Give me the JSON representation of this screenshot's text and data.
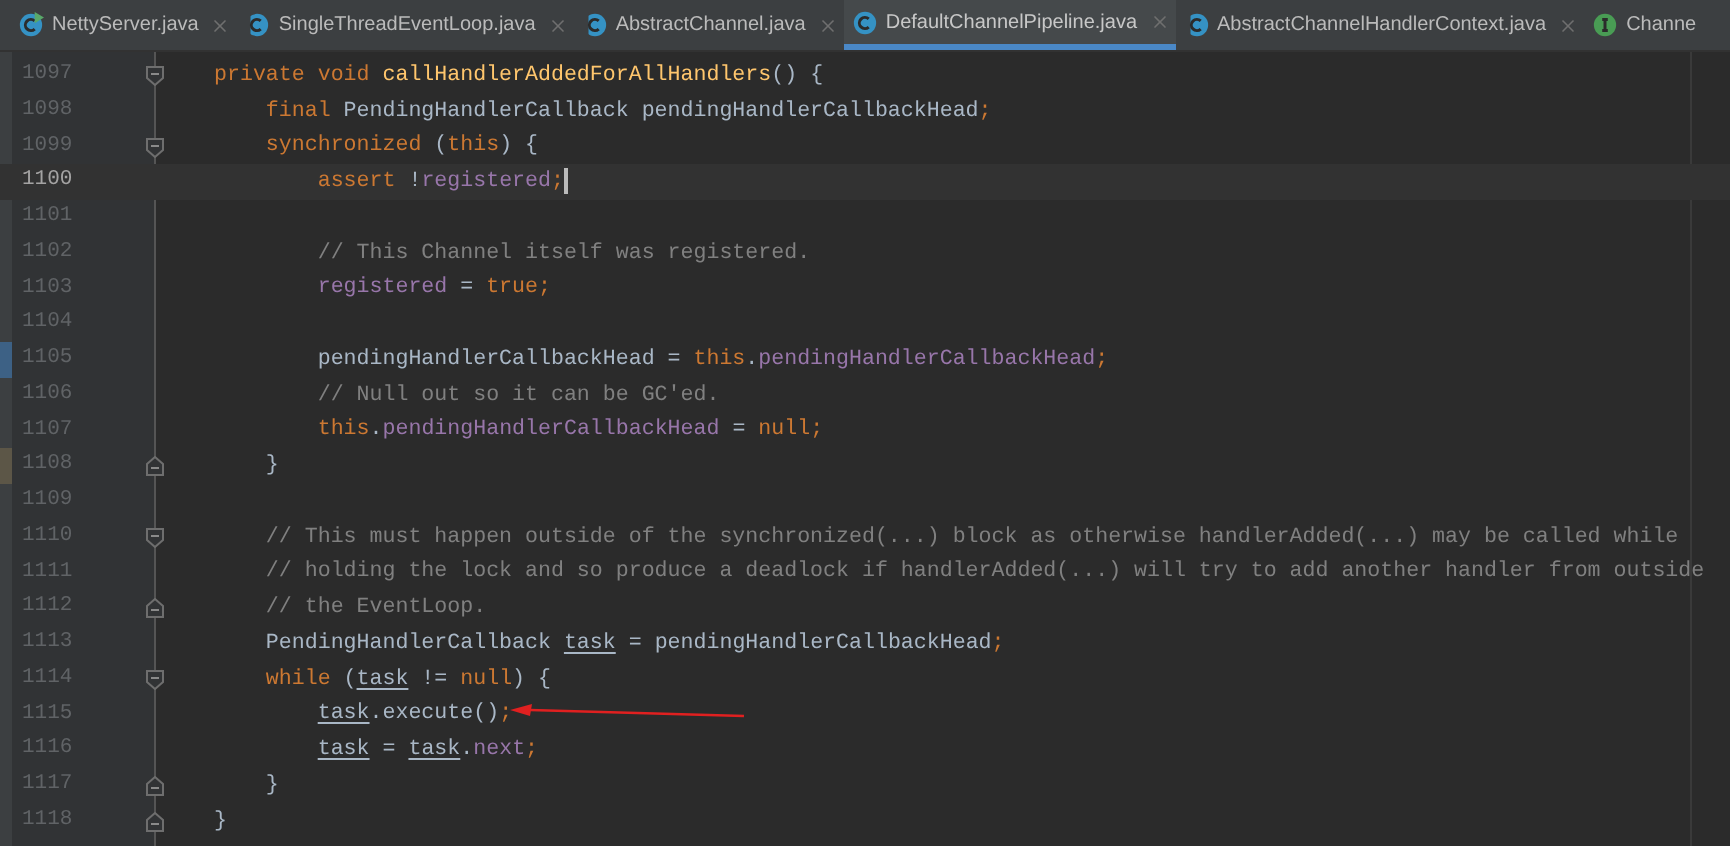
{
  "tabs": [
    {
      "label": "NettyServer.java",
      "kind": "class-run",
      "selected": false
    },
    {
      "label": "SingleThreadEventLoop.java",
      "kind": "abstract-class",
      "selected": false
    },
    {
      "label": "AbstractChannel.java",
      "kind": "abstract-class",
      "selected": false
    },
    {
      "label": "DefaultChannelPipeline.java",
      "kind": "class",
      "selected": true
    },
    {
      "label": "AbstractChannelHandlerContext.java",
      "kind": "abstract-class",
      "selected": false
    },
    {
      "label": "Channe",
      "kind": "interface",
      "selected": false
    }
  ],
  "lines": [
    {
      "number": "1097",
      "current": false,
      "kind": "fold-start",
      "tokens": [
        {
          "kind": "keyword",
          "text": "private void "
        },
        {
          "kind": "method",
          "text": "callHandlerAddedForAllHandlers"
        },
        {
          "kind": "plain",
          "text": "() {"
        }
      ]
    },
    {
      "number": "1098",
      "current": false,
      "kind": "plain",
      "tokens": [
        {
          "kind": "keyword",
          "text": "    final "
        },
        {
          "kind": "plain",
          "text": "PendingHandlerCallback pendingHandlerCallbackHead"
        },
        {
          "kind": "keyword",
          "text": ";"
        }
      ]
    },
    {
      "number": "1099",
      "current": false,
      "kind": "fold-start",
      "tokens": [
        {
          "kind": "keyword",
          "text": "    synchronized "
        },
        {
          "kind": "plain",
          "text": "("
        },
        {
          "kind": "keyword",
          "text": "this"
        },
        {
          "kind": "plain",
          "text": ") {"
        }
      ]
    },
    {
      "number": "1100",
      "current": true,
      "kind": "plain",
      "tokens": [
        {
          "kind": "keyword",
          "text": "        assert "
        },
        {
          "kind": "plain",
          "text": "!"
        },
        {
          "kind": "field",
          "text": "registered"
        },
        {
          "kind": "keyword",
          "text": ";"
        }
      ]
    },
    {
      "number": "1101",
      "current": false,
      "kind": "plain"
    },
    {
      "number": "1102",
      "current": false,
      "kind": "plain",
      "tokens": [
        {
          "kind": "comment",
          "text": "        // This Channel itself was registered."
        }
      ]
    },
    {
      "number": "1103",
      "current": false,
      "kind": "plain",
      "tokens": [
        {
          "kind": "field",
          "text": "        registered "
        },
        {
          "kind": "plain",
          "text": "= "
        },
        {
          "kind": "keyword",
          "text": "true;"
        }
      ]
    },
    {
      "number": "1104",
      "current": false,
      "kind": "plain"
    },
    {
      "number": "1105",
      "current": false,
      "kind": "changed",
      "color": "#3d6185",
      "tokens": [
        {
          "kind": "plain",
          "text": "        pendingHandlerCallbackHead = "
        },
        {
          "kind": "keyword",
          "text": "this"
        },
        {
          "kind": "plain",
          "text": "."
        },
        {
          "kind": "field",
          "text": "pendingHandlerCallbackHead"
        },
        {
          "kind": "keyword",
          "text": ";"
        }
      ]
    },
    {
      "number": "1106",
      "current": false,
      "kind": "plain",
      "tokens": [
        {
          "kind": "comment",
          "text": "        // Null out so it can be GC'ed."
        }
      ]
    },
    {
      "number": "1107",
      "current": false,
      "kind": "plain",
      "tokens": [
        {
          "kind": "keyword",
          "text": "        this"
        },
        {
          "kind": "plain",
          "text": "."
        },
        {
          "kind": "field",
          "text": "pendingHandlerCallbackHead "
        },
        {
          "kind": "plain",
          "text": "= "
        },
        {
          "kind": "keyword",
          "text": "null;"
        }
      ]
    },
    {
      "number": "1108",
      "current": false,
      "kind": "fold-end-changed",
      "color": "#5c5647",
      "tokens": [
        {
          "kind": "plain",
          "text": "    }"
        }
      ]
    },
    {
      "number": "1109",
      "current": false,
      "kind": "plain"
    },
    {
      "number": "1110",
      "current": false,
      "kind": "fold-start",
      "tokens": [
        {
          "kind": "comment",
          "text": "    // This must happen outside of the synchronized(...) block as otherwise handlerAdded(...) may be called while"
        }
      ]
    },
    {
      "number": "1111",
      "current": false,
      "kind": "plain",
      "tokens": [
        {
          "kind": "comment",
          "text": "    // holding the lock and so produce a deadlock if handlerAdded(...) will try to add another handler from outside"
        }
      ]
    },
    {
      "number": "1112",
      "current": false,
      "kind": "fold-end",
      "tokens": [
        {
          "kind": "comment",
          "text": "    // the EventLoop."
        }
      ]
    },
    {
      "number": "1113",
      "current": false,
      "kind": "plain",
      "tokens": [
        {
          "kind": "plain",
          "text": "    PendingHandlerCallback "
        },
        {
          "kind": "local",
          "text": "task"
        },
        {
          "kind": "plain",
          "text": " = pendingHandlerCallbackHead"
        },
        {
          "kind": "keyword",
          "text": ";"
        }
      ]
    },
    {
      "number": "1114",
      "current": false,
      "kind": "fold-start",
      "tokens": [
        {
          "kind": "keyword",
          "text": "    while "
        },
        {
          "kind": "plain",
          "text": "("
        },
        {
          "kind": "local",
          "text": "task"
        },
        {
          "kind": "plain",
          "text": " != "
        },
        {
          "kind": "keyword",
          "text": "null"
        },
        {
          "kind": "plain",
          "text": ") {"
        }
      ]
    },
    {
      "number": "1115",
      "current": false,
      "kind": "plain",
      "tokens": [
        {
          "kind": "local",
          "text": "        task"
        },
        {
          "kind": "plain",
          "text": ".execute()"
        },
        {
          "kind": "keyword",
          "text": ";"
        }
      ]
    },
    {
      "number": "1116",
      "current": false,
      "kind": "plain",
      "tokens": [
        {
          "kind": "local",
          "text": "        task"
        },
        {
          "kind": "plain",
          "text": " = "
        },
        {
          "kind": "local",
          "text": "task"
        },
        {
          "kind": "plain",
          "text": "."
        },
        {
          "kind": "field",
          "text": "next"
        },
        {
          "kind": "keyword",
          "text": ";"
        }
      ]
    },
    {
      "number": "1117",
      "current": false,
      "kind": "fold-end",
      "tokens": [
        {
          "kind": "plain",
          "text": "    }"
        }
      ]
    },
    {
      "number": "1118",
      "current": false,
      "kind": "fold-end",
      "tokens": [
        {
          "kind": "plain",
          "text": "}"
        }
      ]
    }
  ]
}
